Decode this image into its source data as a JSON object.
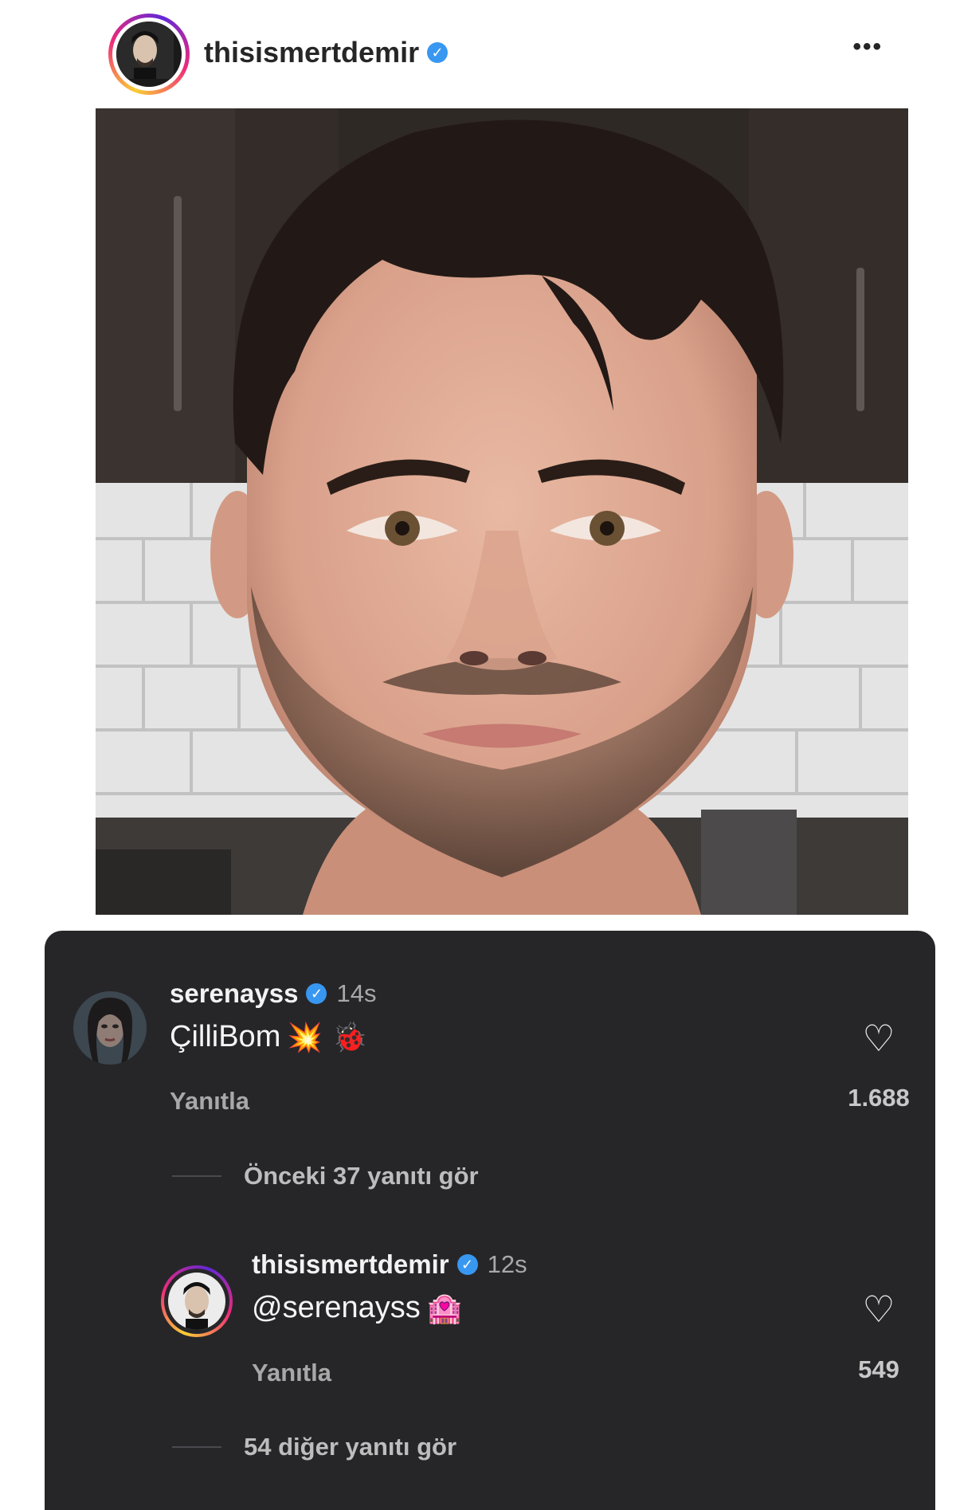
{
  "post": {
    "username": "thisismertdemir",
    "verified_icon": "verified-badge-icon",
    "more_label": "•••"
  },
  "comments": [
    {
      "username": "serenayss",
      "time": "14s",
      "text": "ÇilliBom",
      "emojis": "💥 🐞",
      "reply_label": "Yanıtla",
      "likes": "1.688",
      "view_replies": "Önceki 37 yanıtı gör"
    },
    {
      "username": "thisismertdemir",
      "time": "12s",
      "text": "@serenayss",
      "emojis": "🏩",
      "reply_label": "Yanıtla",
      "likes": "549",
      "view_replies": "54 diğer yanıtı gör"
    }
  ],
  "colors": {
    "panel_bg": "#262629",
    "verified_blue": "#3897f0"
  }
}
